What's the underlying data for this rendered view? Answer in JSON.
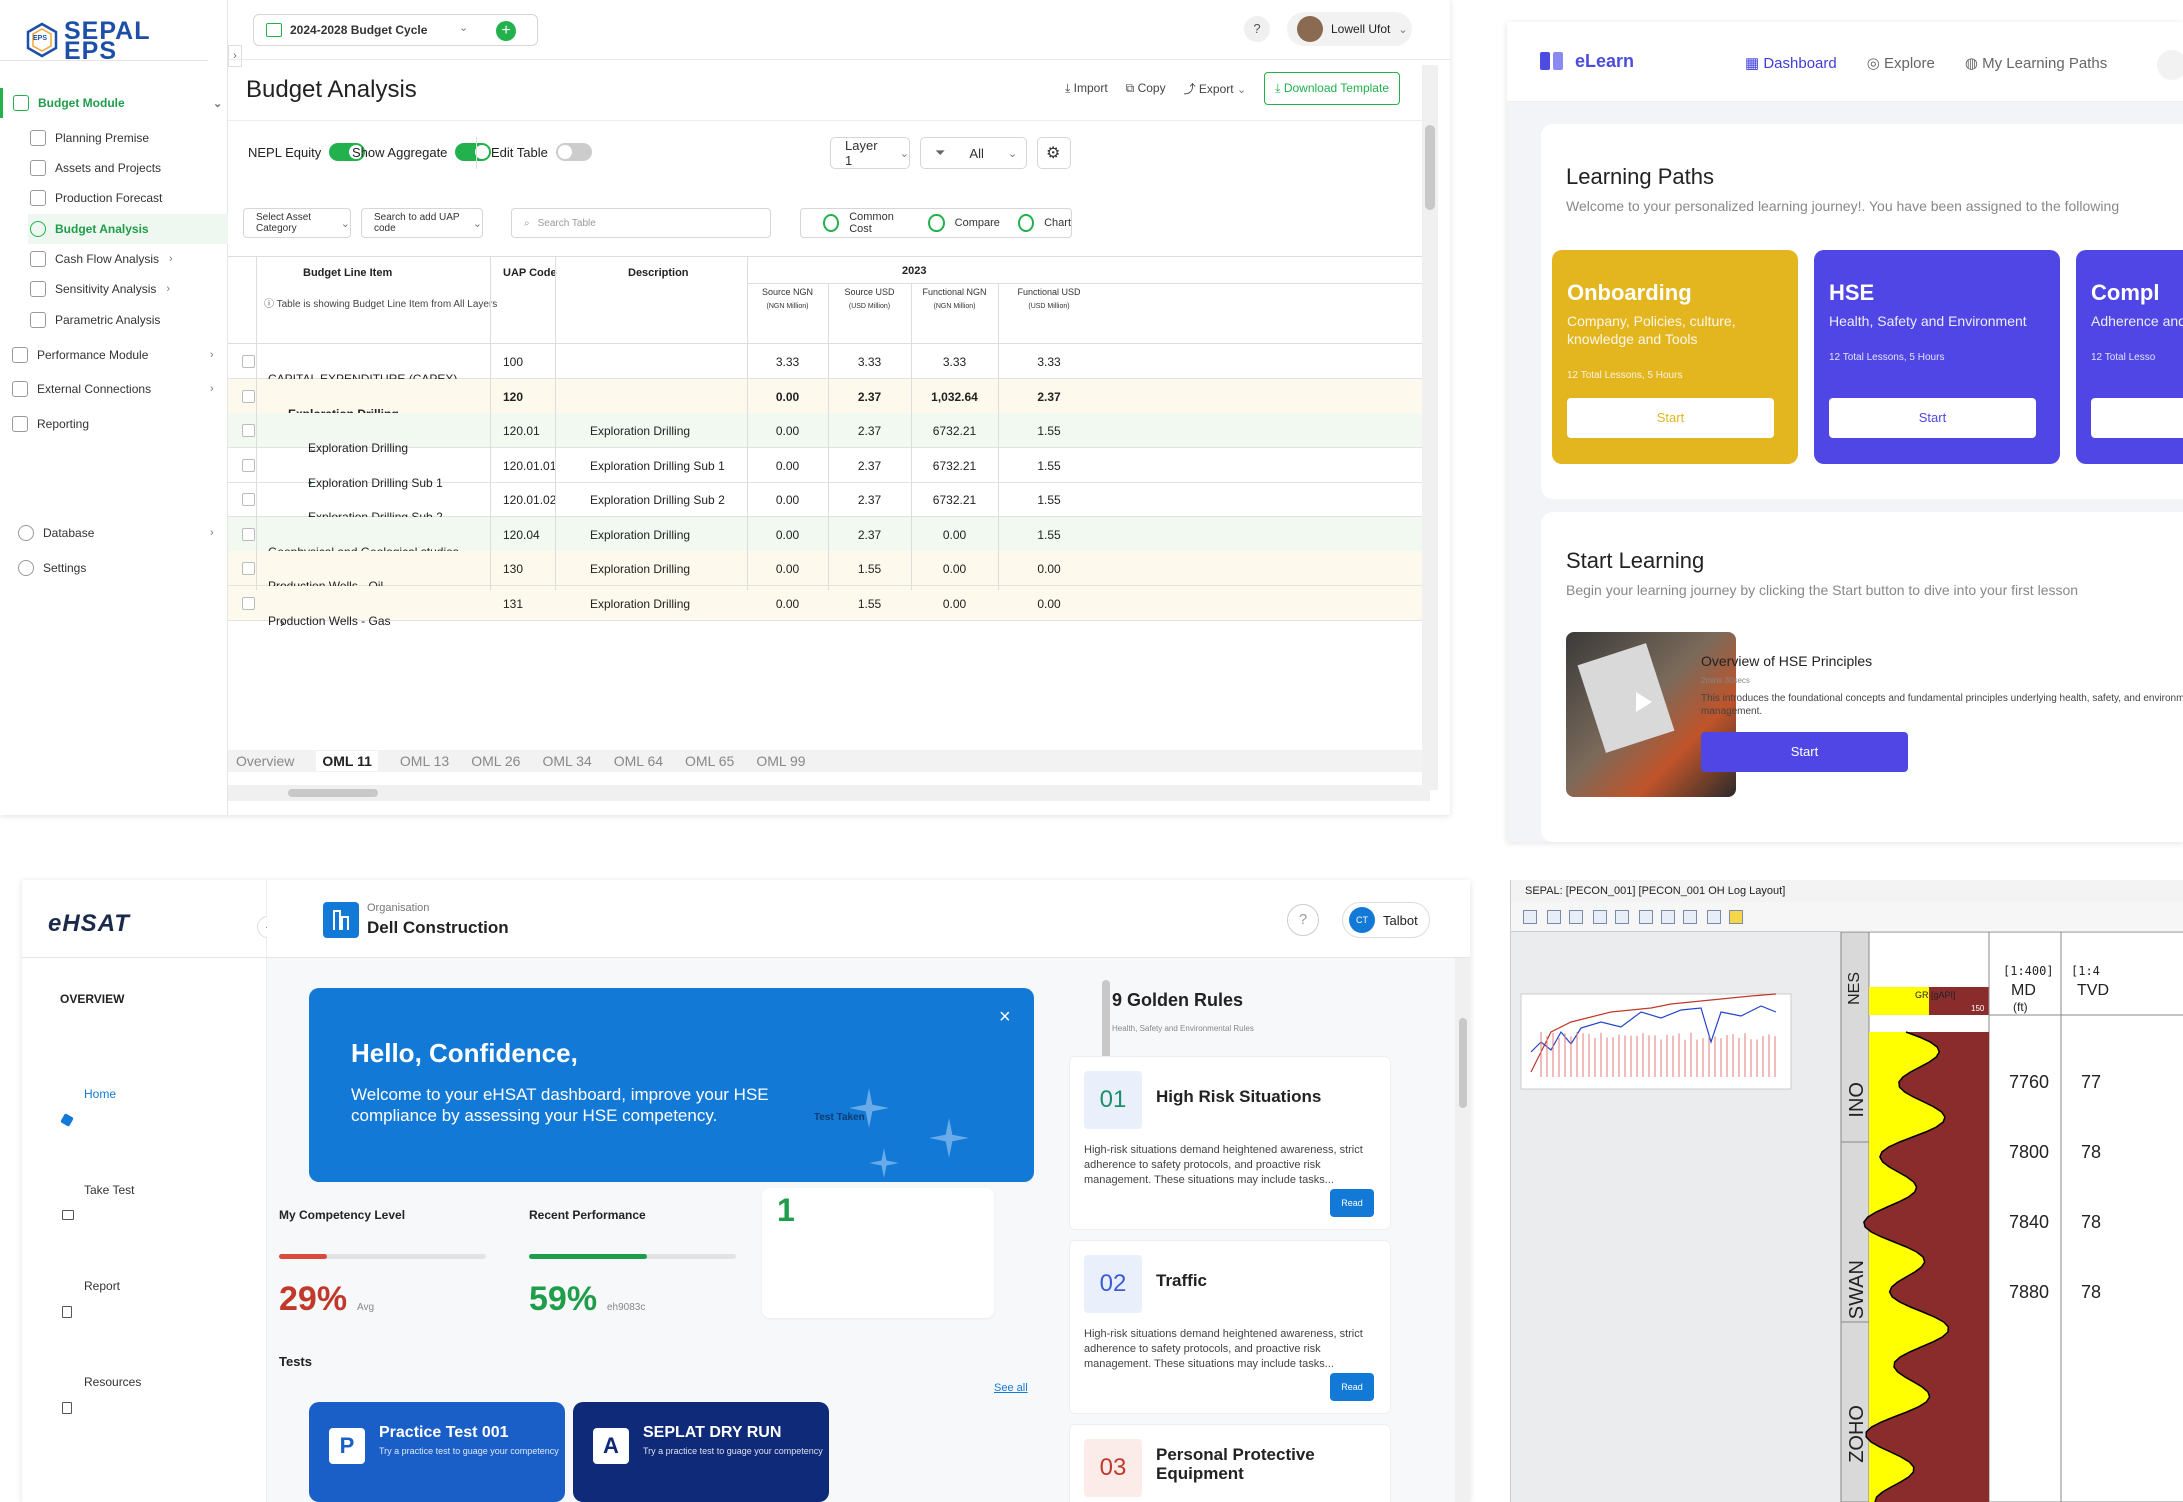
{
  "sepal": {
    "logo_line1": "SEPAL",
    "logo_line2": "EPS",
    "logo_badge": "EPS",
    "nav": {
      "budget_module": "Budget Module",
      "items": [
        "Planning Premise",
        "Assets and Projects",
        "Production Forecast",
        "Budget Analysis",
        "Cash Flow Analysis",
        "Sensitivity Analysis",
        "Parametric Analysis"
      ],
      "performance_module": "Performance Module",
      "external_connections": "External Connections",
      "reporting": "Reporting",
      "database": "Database",
      "settings": "Settings"
    },
    "cycle": "2024-2028 Budget Cycle",
    "help": "?",
    "user_name": "Lowell Ufot",
    "page_title": "Budget Analysis",
    "actions": {
      "import": "Import",
      "copy": "Copy",
      "export": "Export",
      "download_template": "Download Template"
    },
    "controls": {
      "nepl_equity": "NEPL Equity",
      "show_aggregate": "Show Aggregate",
      "edit_table": "Edit Table",
      "layer": "Layer 1",
      "filter": "All"
    },
    "filters": {
      "asset_category": "Select Asset Category",
      "uap_code": "Search to add UAP code",
      "search_placeholder": "Search Table",
      "common_cost": "Common Cost",
      "compare": "Compare",
      "chart": "Chart"
    },
    "table": {
      "headers": {
        "line_item": "Budget Line Item",
        "uap": "UAP Code",
        "desc": "Description",
        "year": "2023",
        "cols": [
          {
            "t": "Source NGN",
            "u": "(NGN Million)"
          },
          {
            "t": "Source USD",
            "u": "(USD Million)"
          },
          {
            "t": "Functional NGN",
            "u": "(NGN Million)"
          },
          {
            "t": "Functional USD",
            "u": "(USD Million)"
          }
        ],
        "info": "Table is showing Budget Line Item from All Layers"
      },
      "rows": [
        {
          "item": "CAPITAL EXPENDITURE (CAPEX)",
          "uap": "100",
          "desc": "",
          "v": [
            "3.33",
            "3.33",
            "3.33",
            "3.33"
          ],
          "bg": "",
          "bold": false
        },
        {
          "item": "Exploration  Drilling",
          "uap": "120",
          "desc": "",
          "v": [
            "0.00",
            "2.37",
            "1,032.64",
            "2.37"
          ],
          "bg": "y",
          "bold": true
        },
        {
          "item": "Exploration  Drilling",
          "uap": "120.01",
          "desc": "Exploration Drilling",
          "v": [
            "0.00",
            "2.37",
            "6732.21",
            "1.55"
          ],
          "bg": "g",
          "bold": false
        },
        {
          "item": "Exploration  Drilling Sub 1",
          "uap": "120.01.01",
          "desc": "Exploration Drilling Sub 1",
          "v": [
            "0.00",
            "2.37",
            "6732.21",
            "1.55"
          ],
          "bg": "",
          "bold": false
        },
        {
          "item": "Exploration  Drilling Sub 2",
          "uap": "120.01.02",
          "desc": "Exploration Drilling Sub 2",
          "v": [
            "0.00",
            "2.37",
            "6732.21",
            "1.55"
          ],
          "bg": "",
          "bold": false
        },
        {
          "item": "Geophysical and Geological studies",
          "uap": "120.04",
          "desc": "Exploration Drilling",
          "v": [
            "0.00",
            "2.37",
            "0.00",
            "1.55"
          ],
          "bg": "g",
          "bold": false
        },
        {
          "item": "Production Wells - Oil",
          "uap": "130",
          "desc": "Exploration Drilling",
          "v": [
            "0.00",
            "1.55",
            "0.00",
            "0.00"
          ],
          "bg": "y",
          "bold": false
        },
        {
          "item": "Production Wells - Gas",
          "uap": "131",
          "desc": "Exploration Drilling",
          "v": [
            "0.00",
            "1.55",
            "0.00",
            "0.00"
          ],
          "bg": "y",
          "bold": false
        }
      ]
    },
    "tabs": [
      "Overview",
      "OML 11",
      "OML 13",
      "OML 26",
      "OML 34",
      "OML 64",
      "OML 65",
      "OML 99"
    ]
  },
  "elearn": {
    "brand": "eLearn",
    "nav": [
      "Dashboard",
      "Explore",
      "My Learning Paths"
    ],
    "lp_title": "Learning Paths",
    "lp_sub": "Welcome to your personalized learning journey!. You have been assigned to the following",
    "paths": [
      {
        "title": "Onboarding",
        "desc": "Company, Policies, culture, knowledge and Tools",
        "meta": "12 Total Lessons, 5 Hours",
        "btn": "Start",
        "color": "#e3b51f"
      },
      {
        "title": "HSE",
        "desc": "Health, Safety and Environment",
        "meta": "12 Total Lessons, 5 Hours",
        "btn": "Start",
        "color": "#4f46e5"
      },
      {
        "title": "Compl",
        "desc": "Adherence and regul",
        "meta": "12 Total Lesso",
        "btn": "",
        "color": "#4f46e5"
      }
    ],
    "sl_title": "Start Learning",
    "sl_sub": "Begin your learning journey by clicking the Start button to dive into your first lesson",
    "lesson": {
      "title": "Overview of HSE Principles",
      "dur": "2mins 30secs",
      "desc": "This introduces the foundational concepts and fundamental principles underlying health, safety, and environment management.",
      "btn": "Start"
    }
  },
  "ehsat": {
    "logo": "eHSAT",
    "overview": "OVERVIEW",
    "nav": [
      "Home",
      "Take Test",
      "Report",
      "Resources"
    ],
    "org_label": "Organisation",
    "org_name": "Dell Construction",
    "help": "?",
    "user_initials": "CT",
    "user_name": "Talbot",
    "hello_title": "Hello, Confidence,",
    "hello_sub": "Welcome to your eHSAT dashboard, improve your HSE compliance by assessing your HSE competency.",
    "hello_tag": "Test Taken",
    "competency": {
      "label": "My Competency Level",
      "value": "29%",
      "suffix": "Avg",
      "progress": 0.23
    },
    "performance": {
      "label": "Recent Performance",
      "value": "59%",
      "suffix": "eh9083c",
      "progress": 0.57
    },
    "count": "1",
    "tests_label": "Tests",
    "see_all": "See all",
    "tests": [
      {
        "letter": "P",
        "title": "Practice Test 001",
        "sub": "Try a practice test to guage your competency"
      },
      {
        "letter": "A",
        "title": "SEPLAT DRY RUN",
        "sub": "Try a practice test to guage your competency"
      }
    ],
    "rules_title": "9 Golden Rules",
    "rules_sub": "Health, Safety and Environmental Rules",
    "rules": [
      {
        "num": "01",
        "title": "High Risk Situations",
        "desc": "High-risk situations demand heightened awareness, strict adherence to safety protocols, and proactive risk management. These situations may include tasks...",
        "btn": "Read",
        "color": "#1f8f6a"
      },
      {
        "num": "02",
        "title": "Traffic",
        "desc": "High-risk situations demand heightened awareness, strict adherence to safety protocols, and proactive risk management. These situations may include tasks...",
        "btn": "Read",
        "color": "#3d5bd6"
      },
      {
        "num": "03",
        "title": "Personal Protective Equipment",
        "desc": "",
        "btn": "",
        "color": "#c0392b"
      }
    ]
  },
  "log": {
    "title": "SEPAL: [PECON_001] [PECON_001 OH Log Layout]",
    "header_nes": "NES",
    "gr": "GR [gAPI]",
    "gr_max": "150",
    "scale1": "[1:400]",
    "md": "MD",
    "md_unit": "(ft)",
    "scale2": "[1:4",
    "tvd": "TVD",
    "zones": [
      "INO",
      "SWAN",
      "ZOHO"
    ],
    "depths": [
      "7760",
      "7800",
      "7840",
      "7880"
    ],
    "depths2": [
      "77",
      "78",
      "78",
      "78"
    ]
  }
}
